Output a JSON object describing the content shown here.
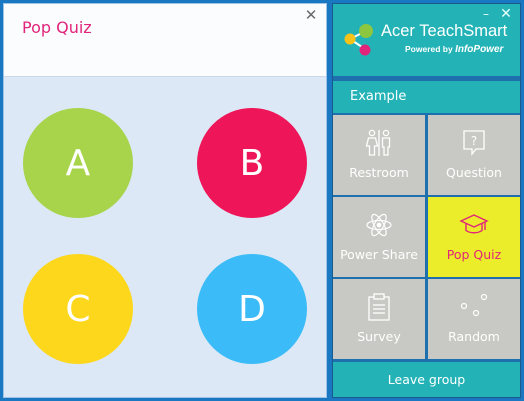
{
  "quiz": {
    "title": "Pop Quiz",
    "close_icon": "close-icon",
    "answers": [
      {
        "label": "A",
        "color": "#a7d44a"
      },
      {
        "label": "B",
        "color": "#ee1558"
      },
      {
        "label": "C",
        "color": "#fdd71c"
      },
      {
        "label": "D",
        "color": "#3bbcf8"
      }
    ]
  },
  "panel": {
    "brand": "Acer TeachSmart",
    "powered_prefix": "Powered by ",
    "powered_brand": "InfoPower",
    "minimize_glyph": "–",
    "close_glyph": "✕",
    "group_name": "Example",
    "leave_label": "Leave group",
    "colors": {
      "teal": "#23b3b7",
      "tile": "#c8c8c4",
      "active_tile": "#eced2a",
      "accent": "#e0257a"
    },
    "tiles": [
      {
        "label": "Restroom",
        "icon": "restroom-icon"
      },
      {
        "label": "Question",
        "icon": "question-icon"
      },
      {
        "label": "Power Share",
        "icon": "atom-icon"
      },
      {
        "label": "Pop Quiz",
        "icon": "graduation-cap-icon",
        "active": true
      },
      {
        "label": "Survey",
        "icon": "clipboard-icon"
      },
      {
        "label": "Random",
        "icon": "dots-icon"
      }
    ]
  }
}
